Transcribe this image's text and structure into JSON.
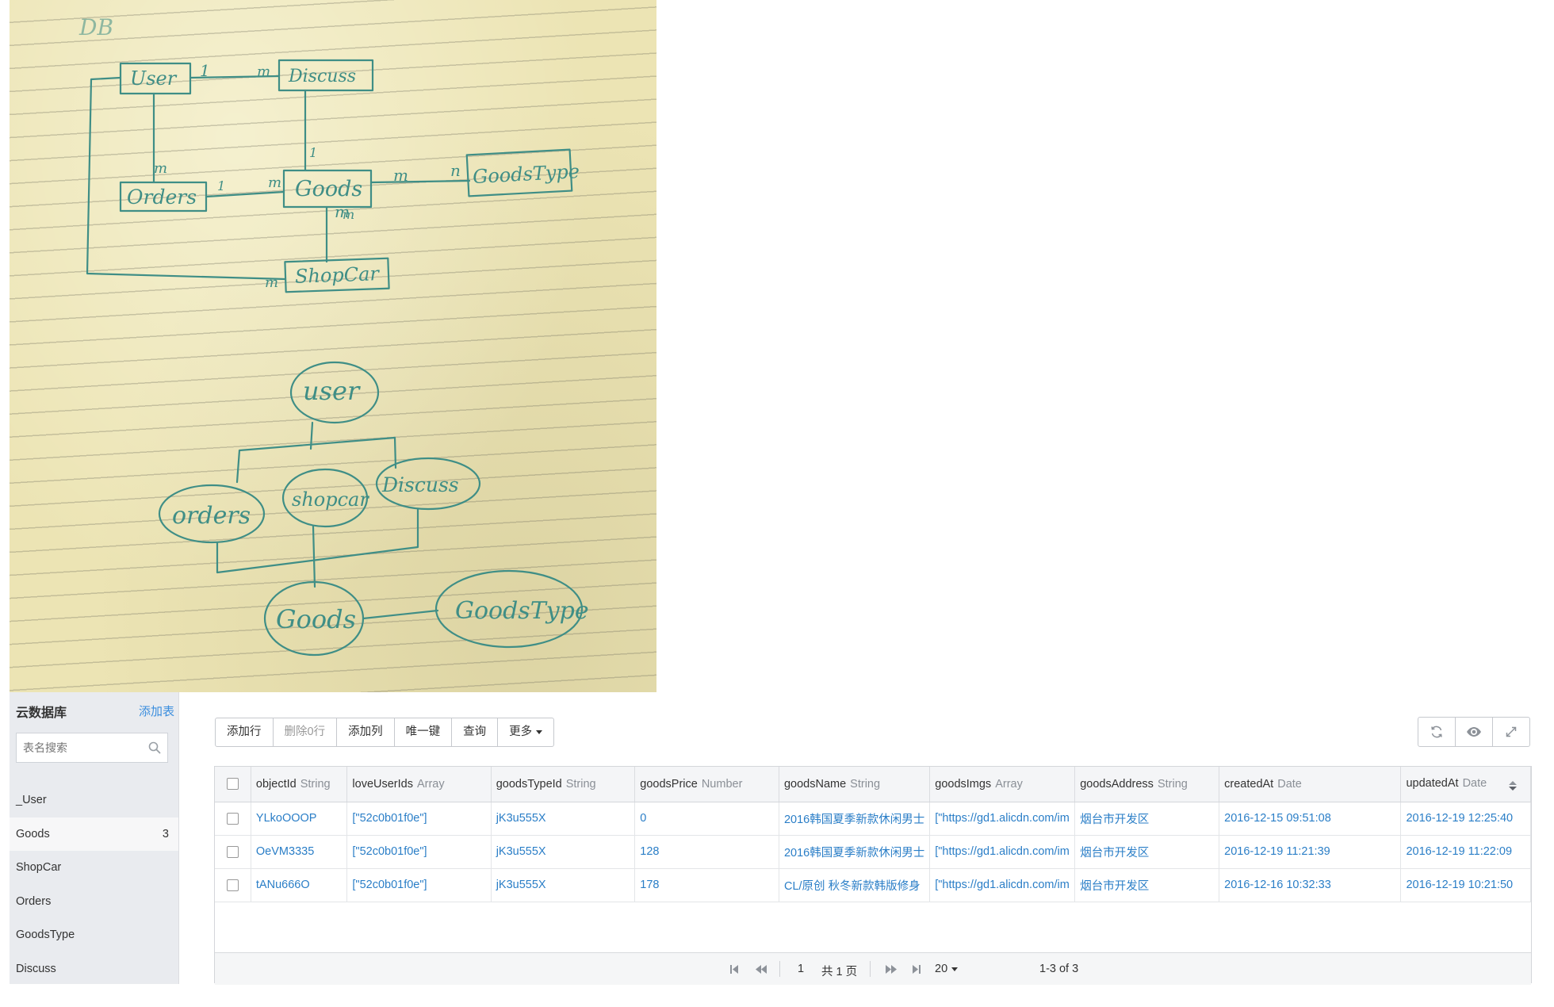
{
  "notes_photo": {
    "title": "DB",
    "er_entities": [
      "User",
      "Discuss",
      "Orders",
      "Goods",
      "GoodsType",
      "ShopCar"
    ],
    "er_cardinalities": [
      "1",
      "m",
      "1",
      "m",
      "m",
      "1",
      "m",
      "m",
      "n",
      "m",
      "m"
    ],
    "tree_nodes": [
      "user",
      "orders",
      "shopcar",
      "Discuss",
      "Goods",
      "GoodsType"
    ]
  },
  "sidebar": {
    "title": "云数据库",
    "add_table": "添加表",
    "search_placeholder": "表名搜索",
    "items": [
      {
        "label": "_User",
        "count": ""
      },
      {
        "label": "Goods",
        "count": "3"
      },
      {
        "label": "ShopCar",
        "count": ""
      },
      {
        "label": "Orders",
        "count": ""
      },
      {
        "label": "GoodsType",
        "count": ""
      },
      {
        "label": "Discuss",
        "count": ""
      }
    ],
    "active": "Goods"
  },
  "toolbar": {
    "add_row": "添加行",
    "delete_rows": "删除0行",
    "add_col": "添加列",
    "unique_key": "唯一键",
    "query": "查询",
    "more": "更多"
  },
  "right_buttons": [
    "refresh-icon",
    "eye-icon",
    "expand-icon"
  ],
  "table": {
    "columns": [
      {
        "name": "objectId",
        "type": "String"
      },
      {
        "name": "loveUserIds",
        "type": "Array"
      },
      {
        "name": "goodsTypeId",
        "type": "String"
      },
      {
        "name": "goodsPrice",
        "type": "Number"
      },
      {
        "name": "goodsName",
        "type": "String"
      },
      {
        "name": "goodsImgs",
        "type": "Array"
      },
      {
        "name": "goodsAddress",
        "type": "String"
      },
      {
        "name": "createdAt",
        "type": "Date"
      },
      {
        "name": "updatedAt",
        "type": "Date"
      }
    ],
    "rows": [
      [
        "YLkoOOOP",
        "[\"52c0b01f0e\"]",
        "jK3u555X",
        "0",
        "2016韩国夏季新款休闲男士",
        "[\"https://gd1.alicdn.com/im",
        "烟台市开发区",
        "2016-12-15 09:51:08",
        "2016-12-19 12:25:40"
      ],
      [
        "OeVM3335",
        "[\"52c0b01f0e\"]",
        "jK3u555X",
        "128",
        "2016韩国夏季新款休闲男士",
        "[\"https://gd1.alicdn.com/im",
        "烟台市开发区",
        "2016-12-19 11:21:39",
        "2016-12-19 11:22:09"
      ],
      [
        "tANu666O",
        "[\"52c0b01f0e\"]",
        "jK3u555X",
        "178",
        "CL/原创 秋冬新款韩版修身",
        "[\"https://gd1.alicdn.com/im",
        "烟台市开发区",
        "2016-12-16 10:32:33",
        "2016-12-19 10:21:50"
      ]
    ]
  },
  "pager": {
    "page": "1",
    "total_pages": "共 1 页",
    "page_size": "20",
    "range": "1-3 of 3"
  }
}
